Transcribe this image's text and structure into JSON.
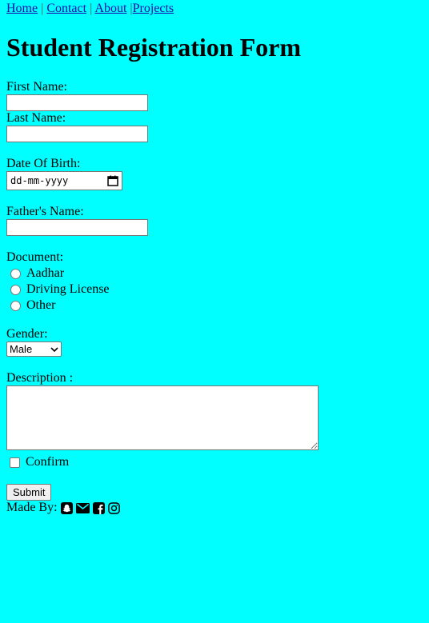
{
  "nav": {
    "links": [
      "Home",
      "Contact",
      "About",
      "Projects"
    ]
  },
  "form": {
    "title": "Student Registration Form",
    "first_name_label": "First Name:",
    "first_name_value": "",
    "last_name_label": "Last Name:",
    "last_name_value": "",
    "dob_label": "Date Of Birth:",
    "dob_placeholder": "dd-mm-yyyy",
    "father_name_label": "Father's Name:",
    "father_name_value": "",
    "document_label": "Document:",
    "document_options": [
      "Aadhar",
      "Driving License",
      "Other"
    ],
    "gender_label": "Gender:",
    "gender_selected": "Male",
    "description_label": "Description :",
    "description_value": "",
    "confirm_label": "Confirm",
    "submit_label": "Submit",
    "made_by_label": "Made By:"
  },
  "social_icons": [
    "snapchat-icon",
    "envelope-icon",
    "facebook-icon",
    "instagram-icon"
  ],
  "colors": {
    "background": "#00ffff",
    "link": "#1a0dab"
  }
}
